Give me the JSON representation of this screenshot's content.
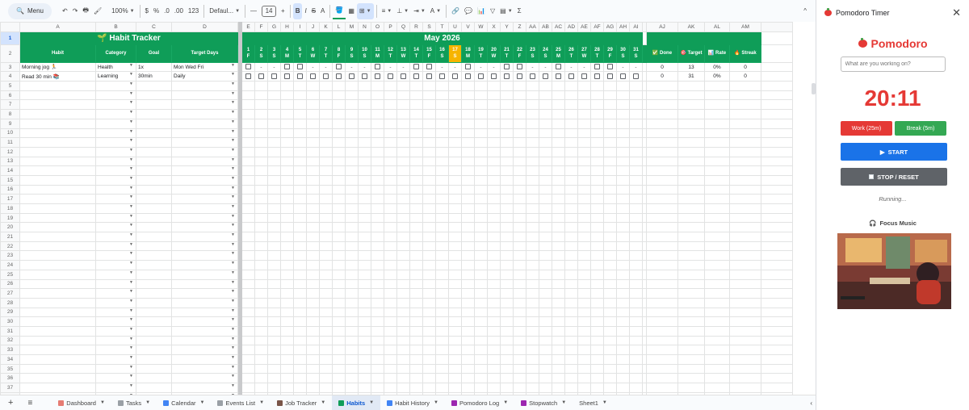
{
  "toolbar": {
    "menu": "Menu",
    "zoom": "100%",
    "currency": "$",
    "percent": "%",
    "dec_less": ".0",
    "dec_more": ".00",
    "format123": "123",
    "font": "Defaul...",
    "font_size": "14",
    "bold": "B",
    "italic": "I",
    "strike": "S",
    "text_color": "A",
    "sum": "Σ",
    "collapse": "^"
  },
  "columns": [
    "A",
    "B",
    "C",
    "D",
    "E",
    "F",
    "G",
    "H",
    "I",
    "J",
    "K",
    "L",
    "M",
    "N",
    "O",
    "P",
    "Q",
    "R",
    "S",
    "T",
    "U",
    "V",
    "W",
    "X",
    "Y",
    "Z",
    "AA",
    "AB",
    "AC",
    "AD",
    "AE",
    "AF",
    "AG",
    "AH",
    "AI",
    "AJ",
    "AK",
    "AL",
    "AM"
  ],
  "sheet": {
    "title": "🌱 Habit Tracker",
    "month": "May 2026",
    "headers": {
      "habit": "Habit",
      "category": "Category",
      "goal": "Goal",
      "target_days": "Target Days",
      "done": "✅ Done",
      "target": "🎯 Target",
      "rate": "📊 Rate",
      "streak": "🔥 Streak"
    },
    "day_numbers": [
      "1",
      "2",
      "3",
      "4",
      "5",
      "6",
      "7",
      "8",
      "9",
      "10",
      "11",
      "12",
      "13",
      "14",
      "15",
      "16",
      "17",
      "18",
      "19",
      "20",
      "21",
      "22",
      "23",
      "24",
      "25",
      "26",
      "27",
      "28",
      "29",
      "30",
      "31"
    ],
    "day_letters": [
      "F",
      "S",
      "S",
      "M",
      "T",
      "W",
      "T",
      "F",
      "S",
      "S",
      "M",
      "T",
      "W",
      "T",
      "F",
      "S",
      "S",
      "M",
      "T",
      "W",
      "T",
      "F",
      "S",
      "S",
      "M",
      "T",
      "W",
      "T",
      "F",
      "S",
      "S"
    ],
    "today_index": 16,
    "habits": [
      {
        "habit": "Morning jog 🏃",
        "category": "Health",
        "goal": "1x",
        "target_days": "Mon Wed Fri",
        "dashes": "",
        "done": "0",
        "target": "13",
        "rate": "0%",
        "streak": "0"
      },
      {
        "habit": "Read 30 min 📚",
        "category": "Learning",
        "goal": "30min",
        "target_days": "Daily",
        "done": "0",
        "target": "31",
        "rate": "0%",
        "streak": "0"
      }
    ],
    "dash": "-",
    "row_numbers": [
      "1",
      "2",
      "3",
      "4",
      "5",
      "6",
      "7",
      "8",
      "9",
      "10",
      "11",
      "12",
      "13",
      "14",
      "15",
      "16",
      "17",
      "18",
      "19",
      "20",
      "21",
      "22",
      "23",
      "24",
      "25",
      "26",
      "27",
      "28",
      "29",
      "30",
      "31",
      "32",
      "33",
      "34",
      "35",
      "36",
      "37",
      "38"
    ]
  },
  "tabs": [
    {
      "label": "Dashboard",
      "color": "#e67c73"
    },
    {
      "label": "Tasks",
      "color": "#9aa0a6"
    },
    {
      "label": "Calendar",
      "color": "#4285f4"
    },
    {
      "label": "Events List",
      "color": "#9aa0a6"
    },
    {
      "label": "Job Tracker",
      "color": "#795548"
    },
    {
      "label": "Habits",
      "color": "#0f9d58"
    },
    {
      "label": "Habit History",
      "color": "#4285f4"
    },
    {
      "label": "Pomodoro Log",
      "color": "#9c27b0"
    },
    {
      "label": "Stopwatch",
      "color": "#9c27b0"
    },
    {
      "label": "Sheet1",
      "color": ""
    }
  ],
  "sidebar": {
    "title": "Pomodoro Timer",
    "brand": "Pomodoro",
    "task_placeholder": "What are you working on?",
    "timer": "20:11",
    "work_label": "Work (25m)",
    "break_label": "Break (5m)",
    "start_label": "START",
    "stop_label": "STOP / RESET",
    "status": "Running...",
    "music_title": "Focus Music",
    "colors": {
      "work": "#e53935",
      "break": "#34a853",
      "start": "#1a73e8",
      "stop": "#5f6368"
    }
  }
}
